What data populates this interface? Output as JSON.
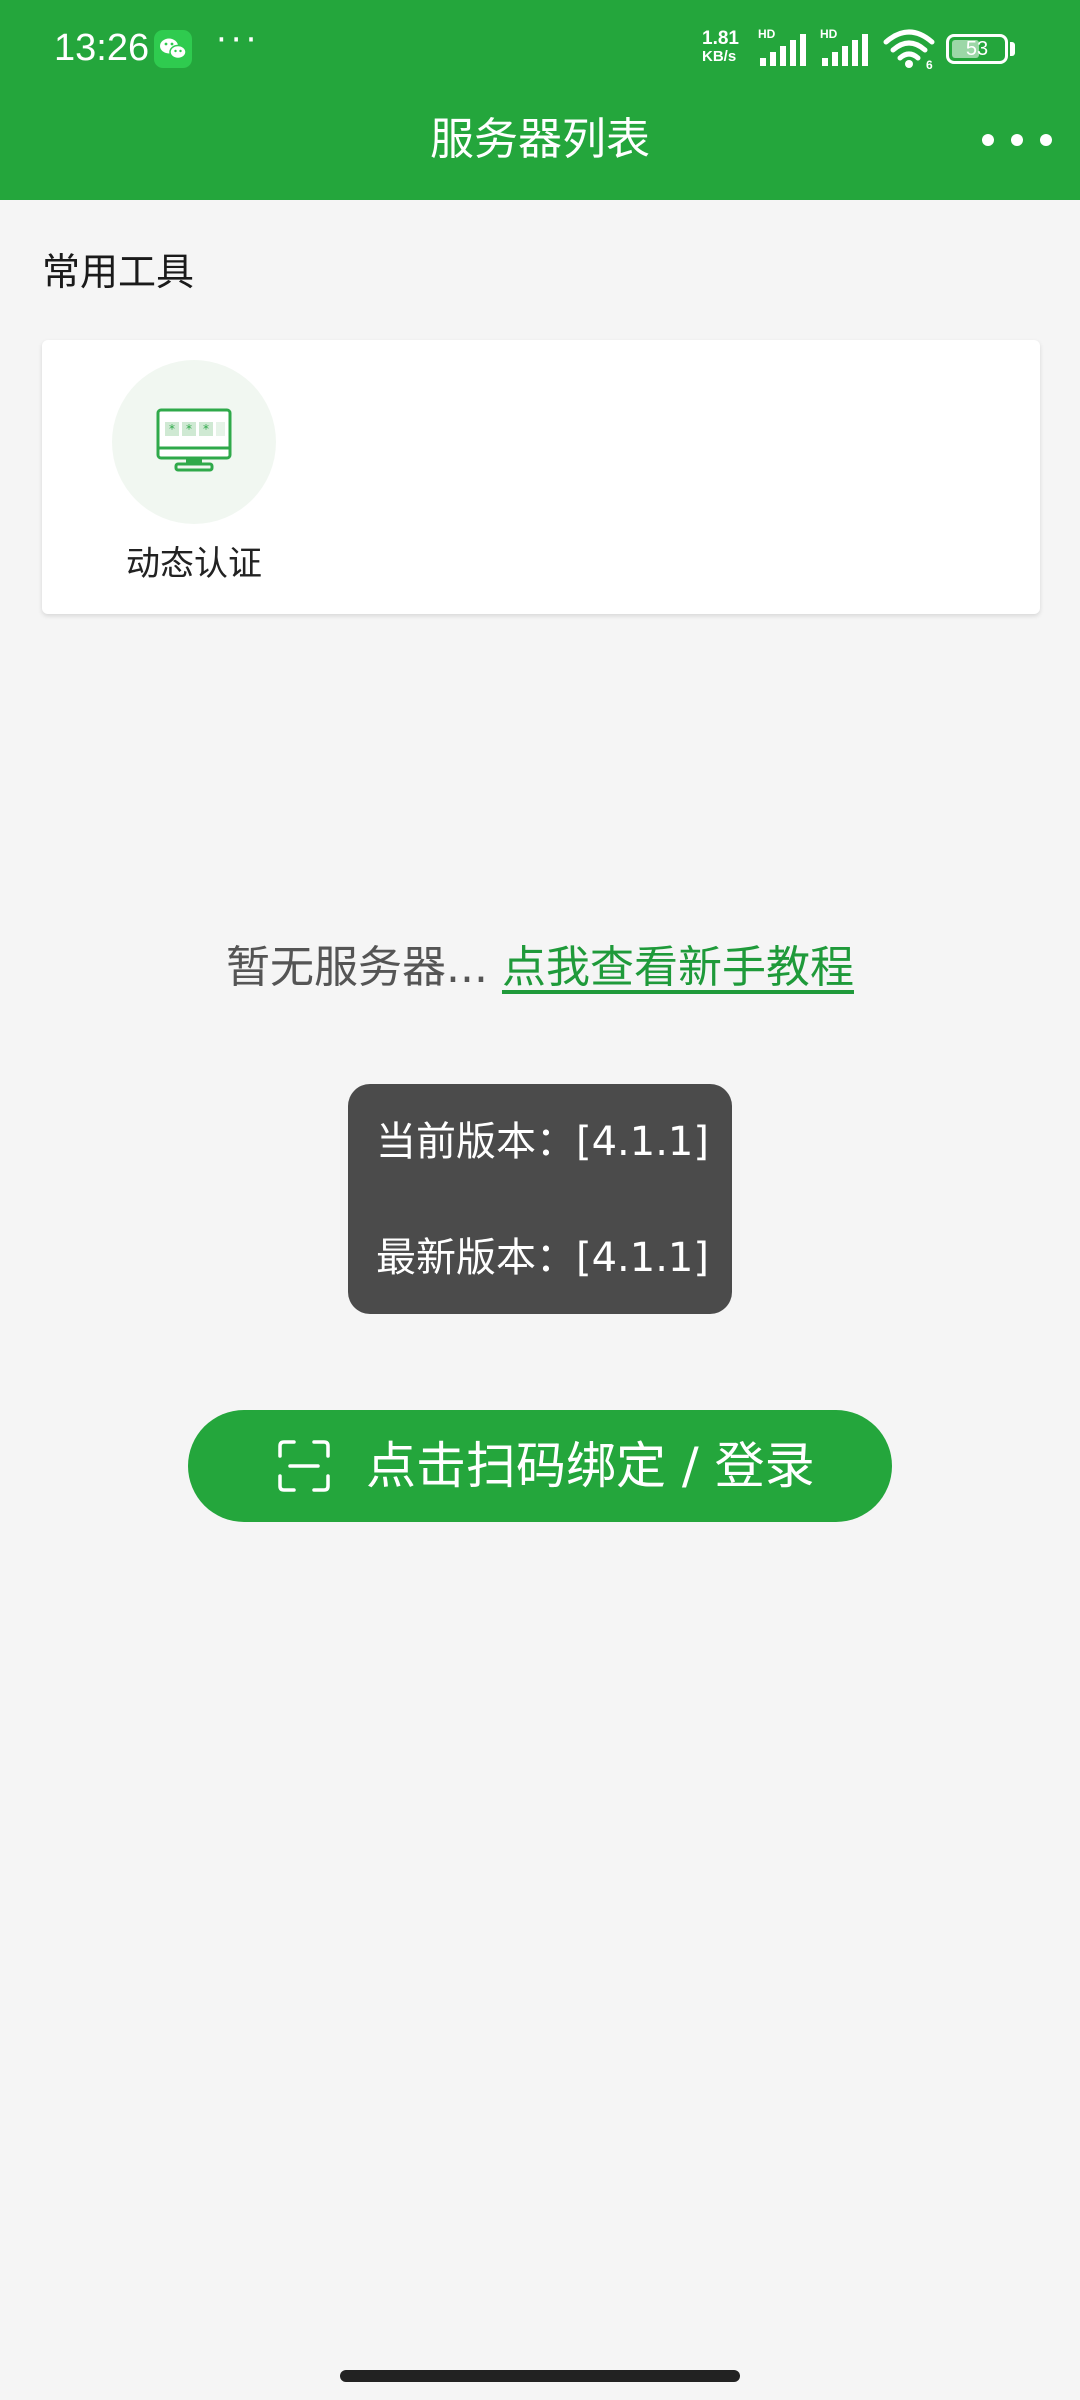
{
  "status_bar": {
    "time": "13:26",
    "more_indicator": "···",
    "net_speed_value": "1.81",
    "net_speed_unit": "KB/s",
    "signal_1_label": "HD",
    "signal_2_label": "HD",
    "wifi_badge": "6",
    "battery": "53",
    "battery_level": 0.53
  },
  "header": {
    "title": "服务器列表"
  },
  "tools": {
    "section_title": "常用工具",
    "items": [
      {
        "label": "动态认证",
        "icon": "monitor-icon"
      }
    ]
  },
  "empty_state": {
    "text": "暂无服务器...",
    "link": "点我查看新手教程"
  },
  "version": {
    "current": "当前版本：[4.1.1]",
    "latest": "最新版本：[4.1.1]"
  },
  "scan_button": {
    "label": "点击扫码绑定 / 登录",
    "icon": "scan-icon"
  },
  "colors": {
    "brand_green": "#24a63c",
    "link_green": "#1f9a3a",
    "toast_bg": "#4b4b4b",
    "page_bg": "#f5f5f5"
  }
}
